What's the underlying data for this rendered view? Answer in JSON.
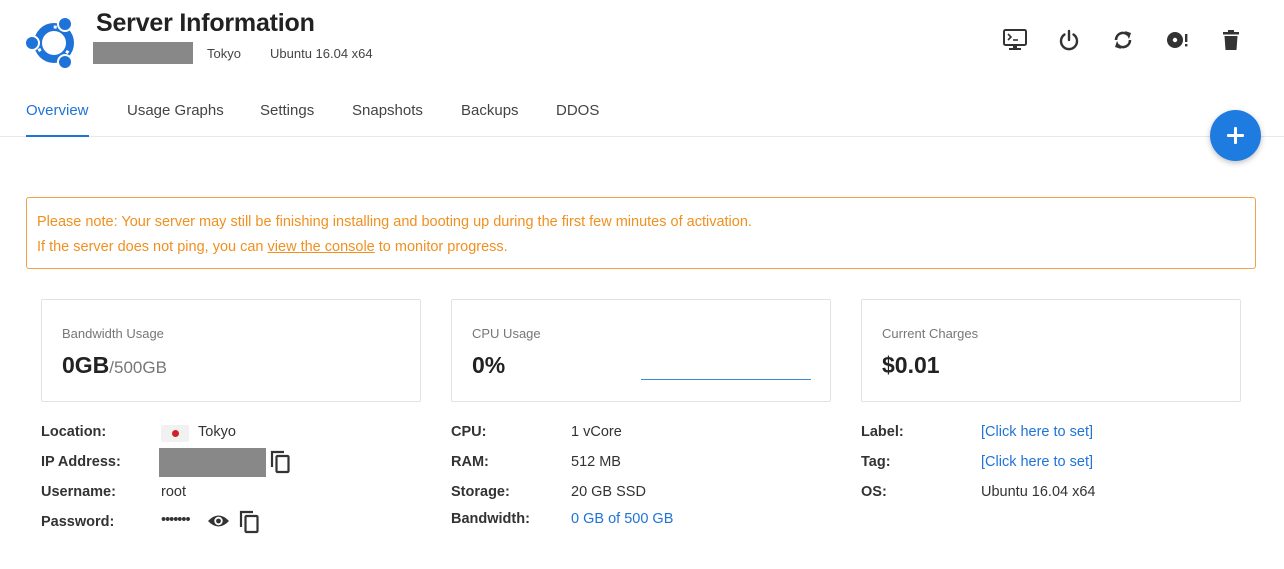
{
  "header": {
    "title": "Server Information",
    "location": "Tokyo",
    "os": "Ubuntu 16.04 x64",
    "os_logo_icon": "ubuntu-logo-icon",
    "toolbar": [
      {
        "name": "console-button",
        "icon": "console-icon"
      },
      {
        "name": "power-button",
        "icon": "power-icon"
      },
      {
        "name": "restart-button",
        "icon": "restart-icon"
      },
      {
        "name": "reinstall-button",
        "icon": "disk-alert-icon"
      },
      {
        "name": "delete-button",
        "icon": "trash-icon"
      }
    ]
  },
  "tabs": [
    {
      "label": "Overview",
      "active": true
    },
    {
      "label": "Usage Graphs",
      "active": false
    },
    {
      "label": "Settings",
      "active": false
    },
    {
      "label": "Snapshots",
      "active": false
    },
    {
      "label": "Backups",
      "active": false
    },
    {
      "label": "DDOS",
      "active": false
    }
  ],
  "notice": {
    "line1": "Please note: Your server may still be finishing installing and booting up during the first few minutes of activation.",
    "line2_before": "If the server does not ping, you can ",
    "line2_link": "view the console",
    "line2_after": " to monitor progress."
  },
  "cards": {
    "bandwidth": {
      "label": "Bandwidth Usage",
      "value": "0GB",
      "total": "/500GB"
    },
    "cpu": {
      "label": "CPU Usage",
      "value": "0%"
    },
    "charges": {
      "label": "Current Charges",
      "value": "$0.01"
    }
  },
  "details": {
    "col1": {
      "location_label": "Location:",
      "location_value": "Tokyo",
      "ip_label": "IP Address:",
      "username_label": "Username:",
      "username_value": "root",
      "password_label": "Password:",
      "password_value": "•••••••"
    },
    "col2": {
      "cpu_label": "CPU:",
      "cpu_value": "1 vCore",
      "ram_label": "RAM:",
      "ram_value": "512 MB",
      "storage_label": "Storage:",
      "storage_value": "20 GB SSD",
      "bandwidth_label": "Bandwidth:",
      "bandwidth_value": "0 GB of 500 GB"
    },
    "col3": {
      "label_label": "Label:",
      "label_value": "[Click here to set]",
      "tag_label": "Tag:",
      "tag_value": "[Click here to set]",
      "os_label": "OS:",
      "os_value": "Ubuntu 16.04 x64"
    }
  },
  "colors": {
    "accent": "#1e73d8",
    "notice": "#f0901f",
    "fab": "#1e7be0"
  }
}
